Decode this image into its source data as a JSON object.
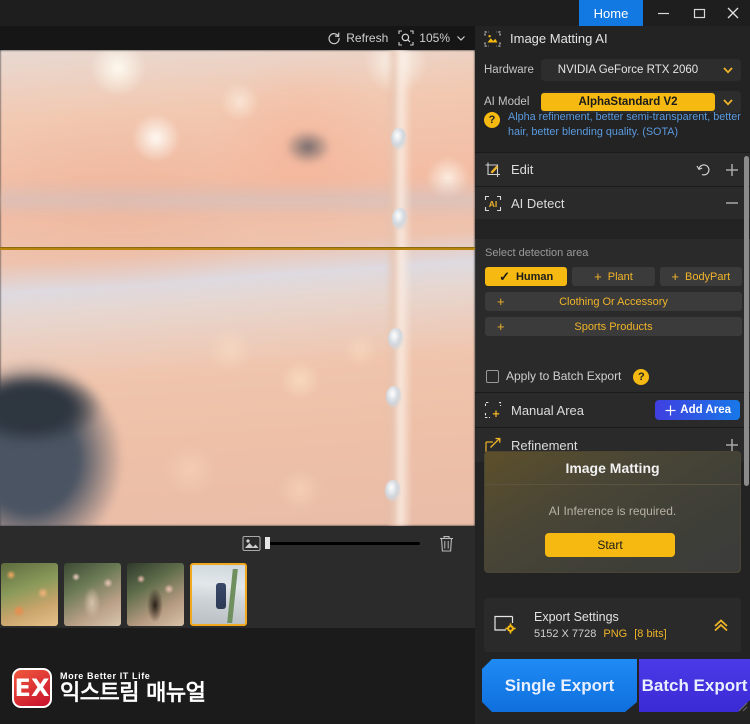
{
  "titlebar": {
    "tab_label": "Home",
    "minimize": "minimize-icon",
    "maximize": "maximize-icon",
    "close": "close-icon"
  },
  "viewer": {
    "refresh_label": "Refresh",
    "zoom_value": "105%",
    "zoom_icon": "magnifier-icon",
    "refresh_icon": "refresh-icon",
    "chevron": "chevron-down-icon"
  },
  "filmstrip": {
    "thumb_size_icon": "image-size-icon",
    "slider_value": "0",
    "delete_icon": "trash-icon",
    "thumbnails": [
      {
        "name": "thumb-1",
        "selected": false
      },
      {
        "name": "thumb-2",
        "selected": false
      },
      {
        "name": "thumb-3",
        "selected": false
      },
      {
        "name": "thumb-4",
        "selected": true
      }
    ]
  },
  "watermark": {
    "mark": "EX",
    "tagline": "More Better IT Life",
    "brand": "익스트림 매뉴얼"
  },
  "panel": {
    "title": "Image Matting AI",
    "title_icon": "image-matting-icon",
    "hardware": {
      "label": "Hardware",
      "value": "NVIDIA GeForce RTX 2060"
    },
    "ai_model": {
      "label": "AI Model",
      "value": "AlphaStandard  V2"
    },
    "hint": "Alpha refinement, better semi-transparent, better hair, better blending quality. (SOTA)",
    "edit": {
      "title": "Edit",
      "icon": "edit-crop-icon",
      "undo_icon": "undo-icon",
      "add_icon": "plus-icon"
    },
    "ai_detect": {
      "title": "AI Detect",
      "icon": "ai-frame-icon",
      "collapse_icon": "minus-icon",
      "subtitle": "Select detection area",
      "chips_row1": [
        {
          "label": "Human",
          "active": true,
          "mark": "✓"
        },
        {
          "label": "Plant",
          "active": false,
          "mark": "+"
        },
        {
          "label": "BodyPart",
          "active": false,
          "mark": "+"
        }
      ],
      "chips_row2": [
        {
          "label": "Clothing Or Accessory",
          "active": false,
          "mark": "+"
        }
      ],
      "chips_row3": [
        {
          "label": "Sports Products",
          "active": false,
          "mark": "+"
        }
      ],
      "batch_checkbox_label": "Apply to Batch Export",
      "batch_checkbox_checked": false,
      "help_icon": "question-icon"
    },
    "manual_area": {
      "title": "Manual Area",
      "icon": "manual-area-icon",
      "add_button": "Add Area",
      "add_button_icon": "crosshair-icon"
    },
    "refinement": {
      "title": "Refinement",
      "icon": "refinement-icon",
      "add_icon": "plus-icon"
    },
    "matting_card": {
      "title": "Image Matting",
      "message": "AI Inference is required.",
      "start_button": "Start"
    },
    "export_settings": {
      "title": "Export Settings",
      "dimensions": "5152 X 7728",
      "format": "PNG",
      "bit_depth": "[8 bits]",
      "icon": "export-settings-icon",
      "collapse_icon": "chevron-up-double-icon"
    },
    "single_export": "Single Export",
    "batch_export": "Batch Export"
  },
  "colors": {
    "accent_amber": "#f5b911",
    "accent_blue": "#1279e3",
    "hint_blue": "#5a9ae0",
    "panel_bg": "#232323",
    "section_bg": "#2a2a2a",
    "batch_purple": "#4b3ae8"
  }
}
